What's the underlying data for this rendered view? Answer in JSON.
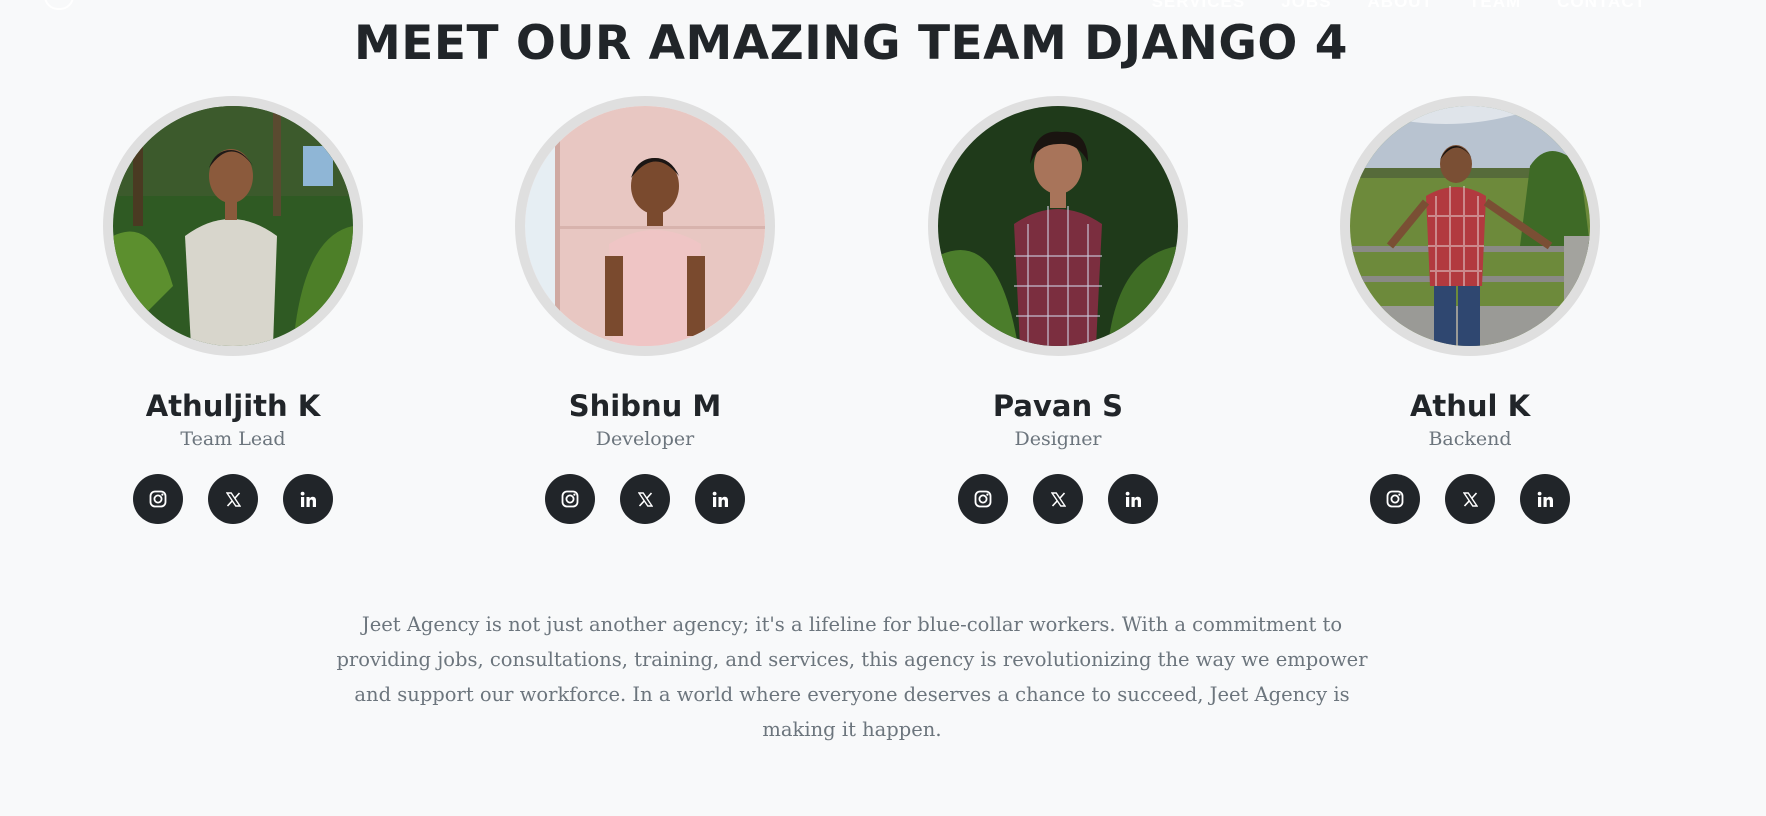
{
  "header": {
    "nav": [
      "SERVICES",
      "JOBS",
      "ABOUT",
      "TEAM",
      "CONTACT"
    ]
  },
  "team": {
    "title": "MEET OUR AMAZING TEAM DJANGO 4",
    "members": [
      {
        "name": "Athuljith K",
        "role": "Team Lead"
      },
      {
        "name": "Shibnu M",
        "role": "Developer"
      },
      {
        "name": "Pavan S",
        "role": "Designer"
      },
      {
        "name": "Athul K",
        "role": "Backend"
      }
    ],
    "social_icons": [
      "instagram-icon",
      "x-twitter-icon",
      "linkedin-icon"
    ]
  },
  "about": {
    "text": "Jeet Agency is not just another agency; it's a lifeline for blue-collar workers. With a commitment to providing jobs, consultations, training, and services, this agency is revolutionizing the way we empower and support our workforce. In a world where everyone deserves a chance to succeed, Jeet Agency is making it happen."
  },
  "colors": {
    "background": "#f8f9fa",
    "heading": "#212529",
    "muted_text": "#6c757d",
    "social_button": "#212529",
    "photo_border": "#dfdfdf"
  }
}
